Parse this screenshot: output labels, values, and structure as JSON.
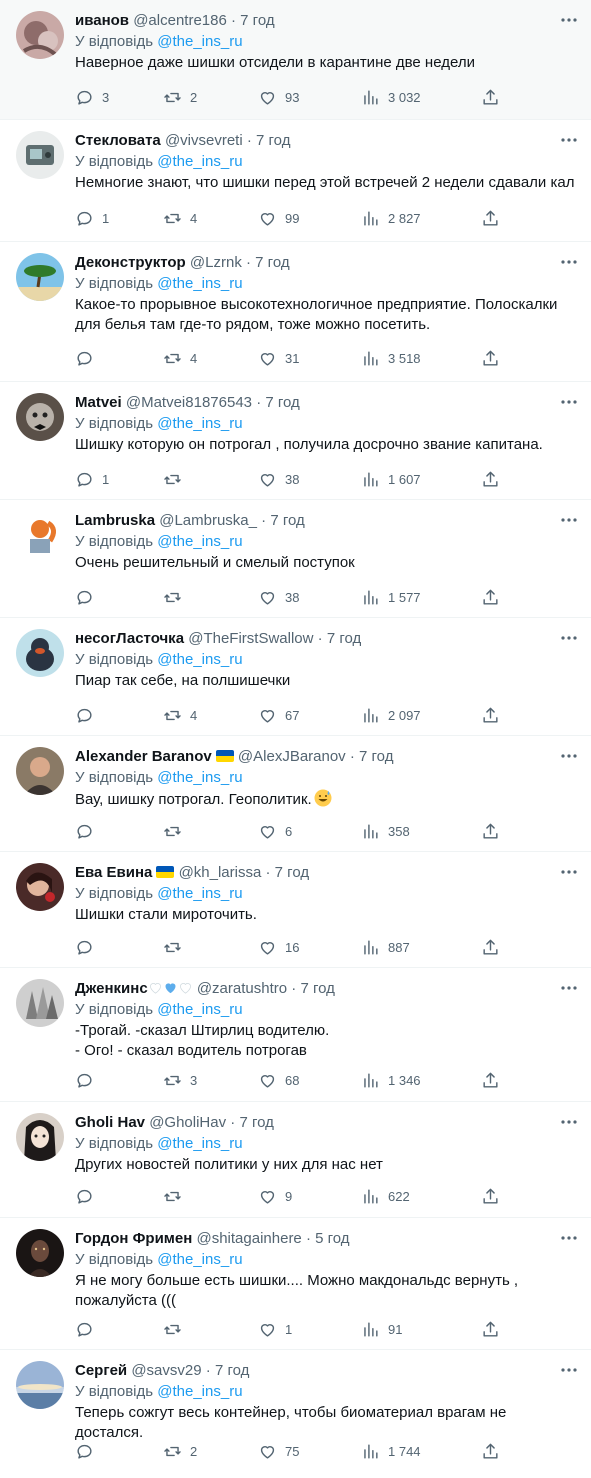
{
  "reply_prefix": "У відповідь",
  "reply_handle": "@the_ins_ru",
  "tweets": [
    {
      "name": "иванов",
      "handle": "@alcentre186",
      "time": "7 год",
      "text": "Наверное даже шишки отсидели в карантине две недели",
      "replies": "3",
      "retweets": "2",
      "likes": "93",
      "views": "3 032"
    },
    {
      "name": "Стекловата",
      "handle": "@vivsevreti",
      "time": "7 год",
      "text": "Немногие знают, что шишки перед этой встречей 2 недели сдавали кал",
      "replies": "1",
      "retweets": "4",
      "likes": "99",
      "views": "2 827"
    },
    {
      "name": "Деконструктор",
      "handle": "@Lzrnk",
      "time": "7 год",
      "text": "Какое-то прорывное высокотехнологичное предприятие. Полоскалки\nдля белья там где-то рядом, тоже можно посетить.",
      "replies": "",
      "retweets": "4",
      "likes": "31",
      "views": "3 518"
    },
    {
      "name": "Matvei",
      "handle": "@Matvei81876543",
      "time": "7 год",
      "text": "Шишку которую он потрогал , получила досрочно звание капитана.",
      "replies": "1",
      "retweets": "",
      "likes": "38",
      "views": "1 607"
    },
    {
      "name": "Lambruska",
      "handle": "@Lambruska_",
      "time": "7 год",
      "text": "Очень решительный и смелый поступок",
      "replies": "",
      "retweets": "",
      "likes": "38",
      "views": "1 577"
    },
    {
      "name": "несогЛасточка",
      "handle": "@TheFirstSwallow",
      "time": "7 год",
      "text": "Пиар так себе, на полшишечки",
      "replies": "",
      "retweets": "4",
      "likes": "67",
      "views": "2 097"
    },
    {
      "name": "Alexander Baranov",
      "handle": "@AlexJBaranov",
      "time": "7 год",
      "text": "Вау, шишку потрогал. Геополитик.",
      "replies": "",
      "retweets": "",
      "likes": "6",
      "views": "358"
    },
    {
      "name": "Ева Евина",
      "handle": "@kh_larissa",
      "time": "7 год",
      "text": "Шишки стали мироточить.",
      "replies": "",
      "retweets": "",
      "likes": "16",
      "views": "887"
    },
    {
      "name": "Дженкинс",
      "handle": "@zaratushtro",
      "time": "7 год",
      "text": "-Трогай. -сказал Штирлиц водителю.\n- Ого! - сказал водитель потрогав",
      "replies": "",
      "retweets": "3",
      "likes": "68",
      "views": "1 346"
    },
    {
      "name": "Gholi Hav",
      "handle": "@GholiHav",
      "time": "7 год",
      "text": "Других новостей политики у них для нас нет",
      "replies": "",
      "retweets": "",
      "likes": "9",
      "views": "622"
    },
    {
      "name": "Гордон Фримен",
      "handle": "@shitagainhere",
      "time": "5 год",
      "text": "Я не могу больше есть шишки.... Можно макдональдс вернуть ,\nпожалуйста (((",
      "replies": "",
      "retweets": "",
      "likes": "1",
      "views": "91"
    },
    {
      "name": "Сергей",
      "handle": "@savsv29",
      "time": "7 год",
      "text": "Теперь сожгут весь контейнер, чтобы биоматериал врагам не достался.",
      "replies": "",
      "retweets": "2",
      "likes": "75",
      "views": "1 744"
    }
  ],
  "colors": {
    "link": "#1d9bf0",
    "muted": "#536471",
    "text": "#0f1419",
    "shaded_bg": "#f7f9f9",
    "divider": "#eff3f4",
    "flag_blue": "#0057b7",
    "flag_yellow": "#ffd700"
  },
  "icons": [
    "reply-icon",
    "retweet-icon",
    "like-icon",
    "views-icon",
    "share-icon",
    "more-icon",
    "ukraine-flag-icon",
    "grinning-sweat-emoji",
    "white-heart-emoji",
    "blue-heart-emoji"
  ]
}
